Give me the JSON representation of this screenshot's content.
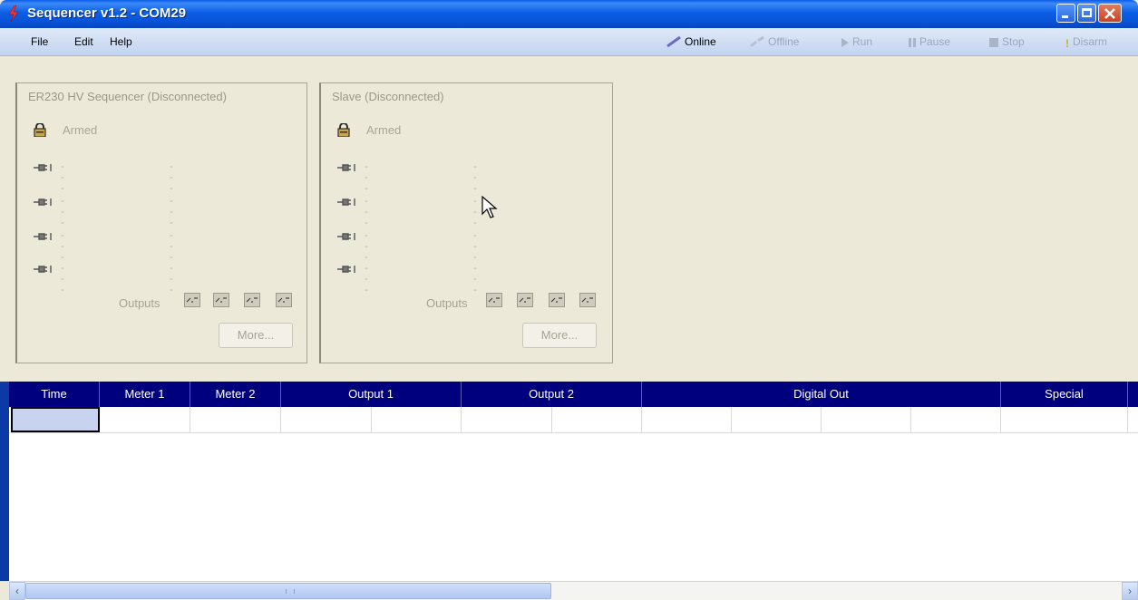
{
  "window": {
    "title": "Sequencer v1.2 - COM29"
  },
  "menu": {
    "items": [
      "File",
      "Edit",
      "Help"
    ]
  },
  "toolbar": {
    "online": "Online",
    "offline": "Offline",
    "run": "Run",
    "pause": "Pause",
    "stop": "Stop",
    "disarm": "Disarm"
  },
  "panels": [
    {
      "title": "ER230 HV Sequencer (Disconnected)",
      "armed": "Armed",
      "rows": [
        {
          "a": "---",
          "b": "---"
        },
        {
          "a": "---",
          "b": "---"
        },
        {
          "a": "---",
          "b": "---"
        },
        {
          "a": "---",
          "b": "---"
        }
      ],
      "outputs_label": "Outputs",
      "more": "More..."
    },
    {
      "title": "Slave (Disconnected)",
      "armed": "Armed",
      "rows": [
        {
          "a": "---",
          "b": "---"
        },
        {
          "a": "---",
          "b": "---"
        },
        {
          "a": "---",
          "b": "---"
        },
        {
          "a": "---",
          "b": "---"
        }
      ],
      "outputs_label": "Outputs",
      "more": "More..."
    }
  ],
  "grid": {
    "headers": [
      "Time",
      "Meter 1",
      "Meter 2",
      "Output 1",
      "Output 2",
      "Digital Out",
      "Special"
    ]
  },
  "colors": {
    "grid_header": "#00007e",
    "selected_cell": "#c7d3ef",
    "window_bg": "#ece9d8"
  }
}
